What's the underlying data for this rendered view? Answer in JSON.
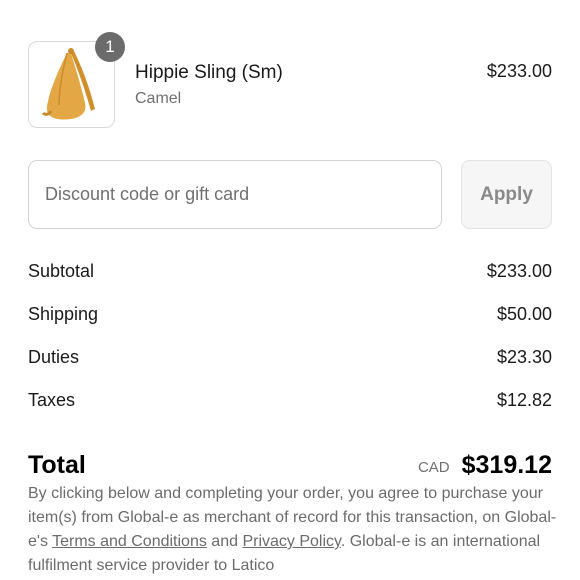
{
  "product": {
    "quantity": "1",
    "name": "Hippie Sling (Sm)",
    "variant": "Camel",
    "price": "$233.00"
  },
  "discount": {
    "placeholder": "Discount code or gift card",
    "apply_label": "Apply"
  },
  "summary": {
    "subtotal_label": "Subtotal",
    "subtotal_value": "$233.00",
    "shipping_label": "Shipping",
    "shipping_value": "$50.00",
    "duties_label": "Duties",
    "duties_value": "$23.30",
    "taxes_label": "Taxes",
    "taxes_value": "$12.82"
  },
  "total": {
    "label": "Total",
    "currency": "CAD",
    "amount": "$319.12"
  },
  "legal": {
    "text_1": "By clicking below and completing your order, you agree to purchase your item(s) from Global-e as merchant of record for this transaction, on Global-e's ",
    "terms_link": "Terms and Conditions",
    "text_2": " and ",
    "privacy_link": "Privacy Policy",
    "text_3": ". Global-e is an international fulfilment service provider to Latico"
  },
  "colors": {
    "badge": "#6b6b6b",
    "bag": "#e0a43c",
    "muted_text": "#707070"
  }
}
